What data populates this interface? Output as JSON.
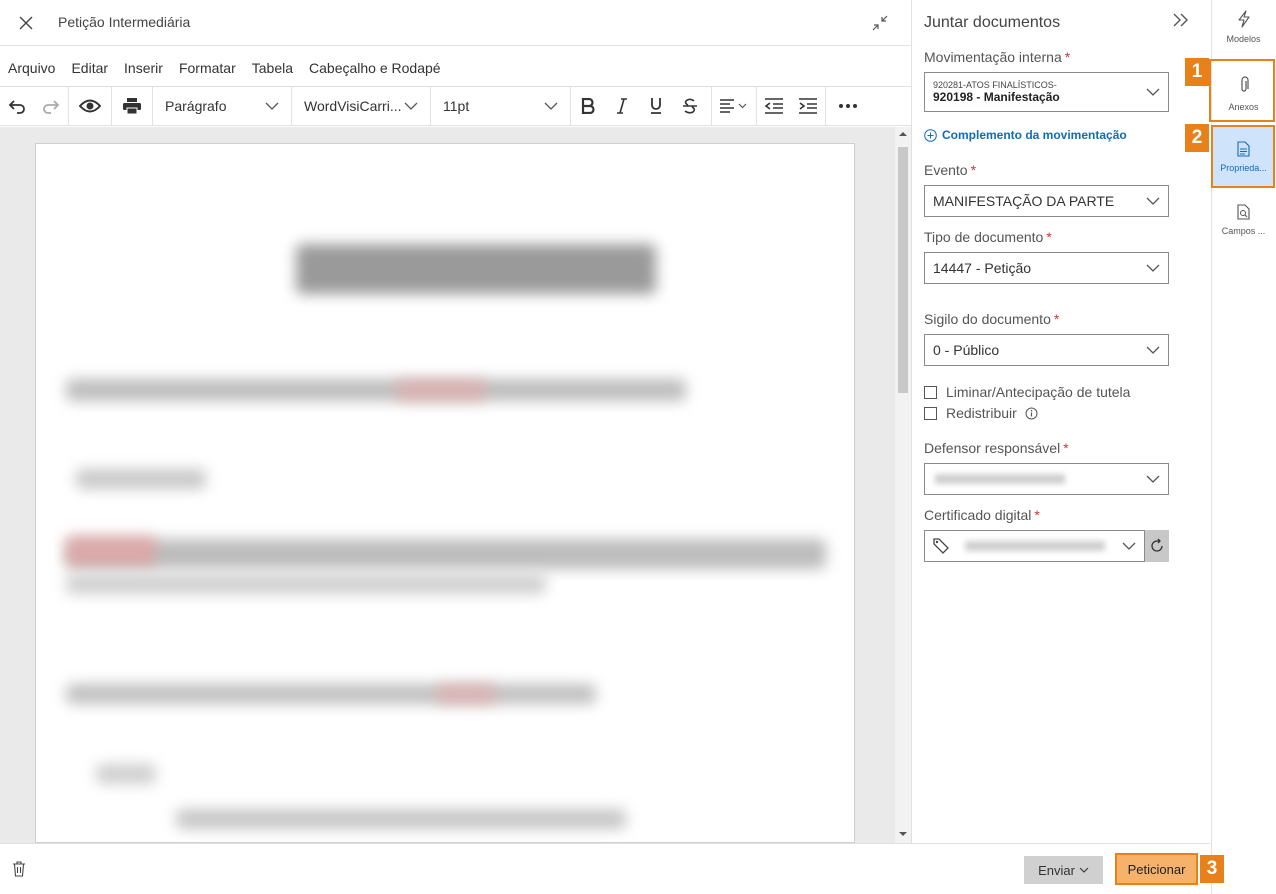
{
  "header": {
    "title": "Petição Intermediária"
  },
  "menu": {
    "items": [
      "Arquivo",
      "Editar",
      "Inserir",
      "Formatar",
      "Tabela",
      "Cabeçalho e Rodapé"
    ]
  },
  "toolbar": {
    "paragraph_style": "Parágrafo",
    "font_family": "WordVisiCarri...",
    "font_size": "11pt"
  },
  "panel": {
    "title": "Juntar documentos",
    "movimentacao": {
      "label": "Movimentação interna",
      "line1": "920281-ATOS FINALÍSTICOS-",
      "line2": "920198 - Manifestação"
    },
    "complemento_link": "Complemento da movimentação",
    "evento": {
      "label": "Evento",
      "value": "MANIFESTAÇÃO DA PARTE"
    },
    "tipo_documento": {
      "label": "Tipo de documento",
      "value": "14447 - Petição"
    },
    "sigilo": {
      "label": "Sigilo do documento",
      "value": "0 - Público"
    },
    "liminar_label": "Liminar/Antecipação de tutela",
    "redistribuir_label": "Redistribuir",
    "defensor": {
      "label": "Defensor responsável",
      "value": ""
    },
    "certificado": {
      "label": "Certificado digital",
      "value": ""
    },
    "required_mark": "*"
  },
  "rail": {
    "modelos": "Modelos",
    "anexos": "Anexos",
    "propriedades": "Proprieda...",
    "campos": "Campos ..."
  },
  "footer": {
    "enviar": "Enviar",
    "peticionar": "Peticionar"
  },
  "callouts": [
    "1",
    "2",
    "3"
  ],
  "colors": {
    "accent_orange": "#e8811a",
    "link_blue": "#0f6cbd",
    "required_red": "#d13438",
    "selected_rail_bg": "#cfe4fa"
  },
  "icons": [
    "close-icon",
    "collapse-icon",
    "undo-icon",
    "redo-icon",
    "eye-icon",
    "print-icon",
    "bold-icon",
    "italic-icon",
    "underline-icon",
    "strikethrough-icon",
    "align-icon",
    "outdent-icon",
    "indent-icon",
    "more-icon",
    "expand-panel-icon",
    "plus-circle-icon",
    "info-icon",
    "tag-icon",
    "refresh-icon",
    "lightning-icon",
    "paperclip-icon",
    "properties-icon",
    "fields-icon",
    "trash-icon"
  ]
}
